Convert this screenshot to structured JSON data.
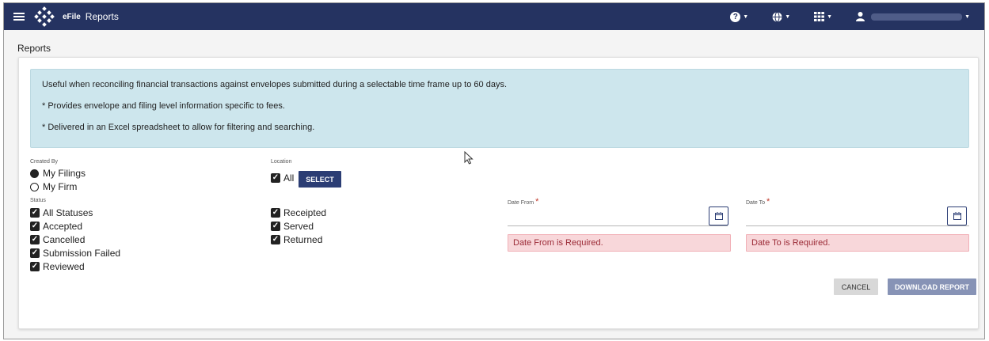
{
  "navbar": {
    "brand": "eFile",
    "page": "Reports",
    "help_icon": "question-circle-icon",
    "globe_icon": "globe-icon",
    "apps_icon": "grid-icon",
    "user_icon": "user-icon",
    "color": "#253361"
  },
  "page": {
    "title": "Reports"
  },
  "info": {
    "line1": "Useful when reconciling financial transactions against envelopes submitted during a selectable time frame up to 60 days.",
    "line2": "* Provides envelope and filing level information specific to fees.",
    "line3": "* Delivered in an Excel spreadsheet to allow for filtering and searching.",
    "color": "#cde6ed"
  },
  "created_by": {
    "label": "Created By",
    "options": [
      {
        "label": "My Filings",
        "selected": true
      },
      {
        "label": "My Firm",
        "selected": false
      }
    ]
  },
  "location": {
    "label": "Location",
    "all_label": "All",
    "select_label": "SELECT"
  },
  "status": {
    "label": "Status",
    "col1": [
      "All Statuses",
      "Accepted",
      "Cancelled",
      "Submission Failed",
      "Reviewed"
    ],
    "col2": [
      "Receipted",
      "Served",
      "Returned"
    ]
  },
  "date_from": {
    "label": "Date From",
    "required_mark": "*",
    "error": "Date From is Required."
  },
  "date_to": {
    "label": "Date To",
    "required_mark": "*",
    "error": "Date To is Required."
  },
  "actions": {
    "cancel": "CANCEL",
    "download": "DOWNLOAD REPORT"
  }
}
